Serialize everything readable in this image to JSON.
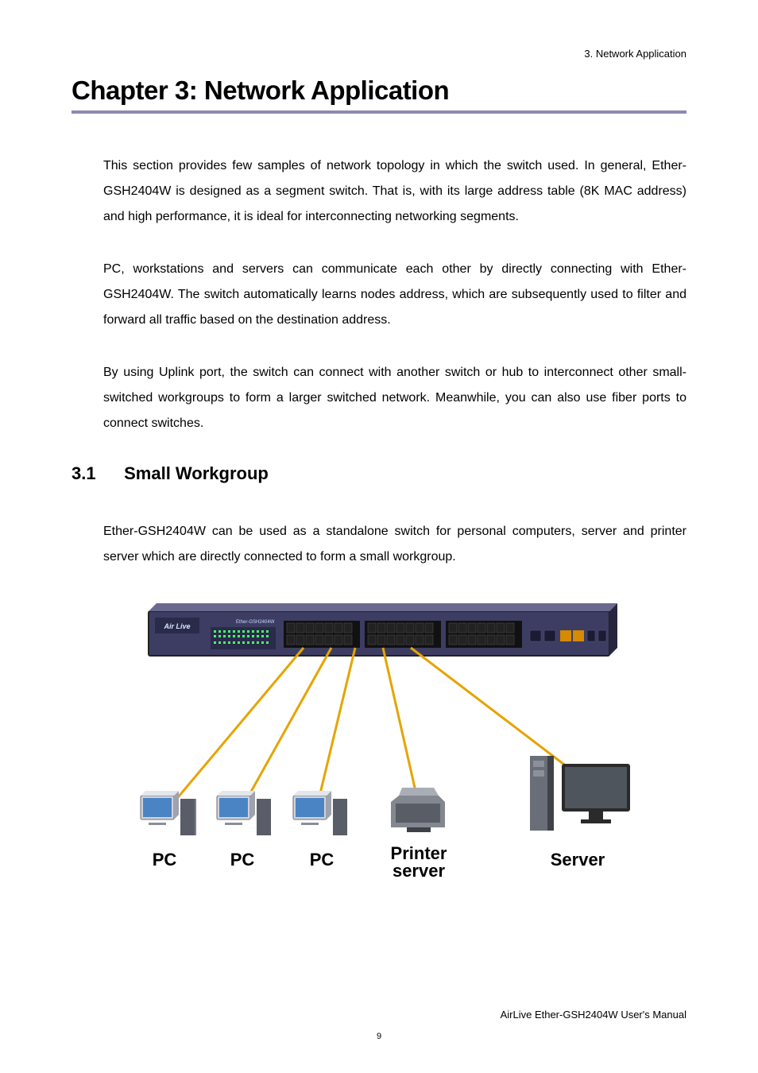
{
  "header": {
    "running": "3. Network Application"
  },
  "chapter": {
    "title": "Chapter 3: Network Application"
  },
  "paragraphs": {
    "p1": "This section provides few samples of network topology in which the switch used. In general, Ether-GSH2404W is designed as a segment switch. That is, with its large address table (8K MAC address) and high performance, it is ideal for interconnecting networking segments.",
    "p2": "PC, workstations and servers can communicate each other by directly connecting with Ether-GSH2404W. The switch automatically learns nodes address, which are subsequently used to filter and forward all traffic based on the destination address.",
    "p3": "By using Uplink port, the switch can connect with another switch or hub to interconnect other small-switched workgroups to form a larger switched network. Meanwhile, you can also use fiber ports to connect switches."
  },
  "section": {
    "num": "3.1",
    "title": "Small Workgroup"
  },
  "section_body": {
    "p1": "Ether-GSH2404W can be used as a standalone switch for personal computers, server and printer server which are directly connected to form a small workgroup."
  },
  "figure": {
    "switch_brand": "Air Live",
    "switch_model": "Ether-GSH2404W",
    "labels": {
      "pc1": "PC",
      "pc2": "PC",
      "pc3": "PC",
      "printer_l1": "Printer",
      "printer_l2": "server",
      "server": "Server"
    }
  },
  "footer": {
    "right": "AirLive Ether-GSH2404W User's Manual",
    "page": "9"
  }
}
